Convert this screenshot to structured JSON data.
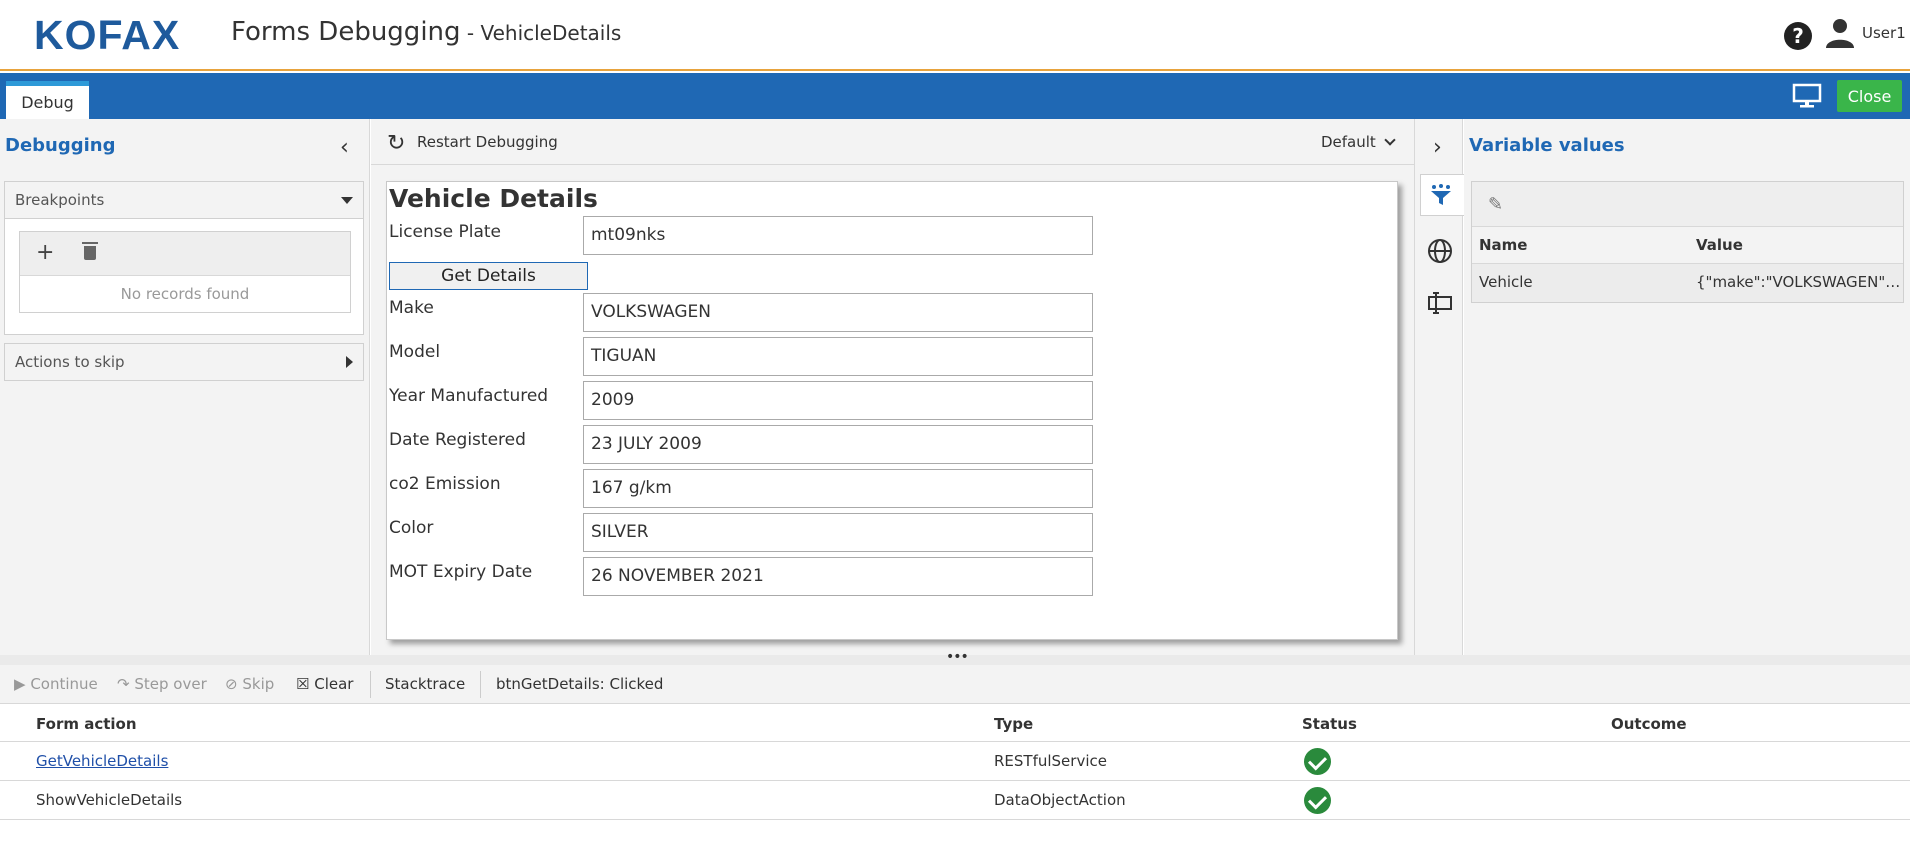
{
  "header": {
    "logo": "KOFAX",
    "title": "Forms Debugging",
    "subtitle": " - VehicleDetails",
    "help_icon": "?",
    "user": "User1"
  },
  "toolbar": {
    "tab": "Debug",
    "close_label": "Close"
  },
  "left_panel": {
    "title": "Debugging",
    "breakpoints_label": "Breakpoints",
    "add_symbol": "+",
    "empty_text": "No records found",
    "actions_to_skip_label": "Actions to skip"
  },
  "center": {
    "restart_label": "Restart Debugging",
    "profile": "Default",
    "form": {
      "title": "Vehicle Details",
      "license_plate_label": "License Plate",
      "license_plate_value": "mt09nks",
      "get_details_label": "Get Details",
      "fields": [
        {
          "label": "Make",
          "value": "VOLKSWAGEN"
        },
        {
          "label": "Model",
          "value": "TIGUAN"
        },
        {
          "label": "Year Manufactured",
          "value": "2009"
        },
        {
          "label": "Date Registered",
          "value": "23 JULY 2009"
        },
        {
          "label": "co2 Emission",
          "value": "167 g/km"
        },
        {
          "label": "Color",
          "value": "SILVER"
        },
        {
          "label": "MOT Expiry Date",
          "value": "26 NOVEMBER 2021"
        }
      ]
    }
  },
  "right_panel": {
    "title": "Variable values",
    "columns": [
      "Name",
      "Value"
    ],
    "rows": [
      {
        "name": "Vehicle",
        "value": "{\"make\":\"VOLKSWAGEN\",\"model\":\"TIGUAN\"}"
      }
    ]
  },
  "debug_bar": {
    "continue": "Continue",
    "step_over": "Step over",
    "skip": "Skip",
    "clear": "Clear",
    "stacktrace": "Stacktrace",
    "event": "btnGetDetails: Clicked"
  },
  "actions_table": {
    "columns": [
      "Form action",
      "Type",
      "Status",
      "Outcome"
    ],
    "rows": [
      {
        "action": "GetVehicleDetails",
        "type": "RESTfulService",
        "status": "success",
        "outcome": ""
      },
      {
        "action": "ShowVehicleDetails",
        "type": "DataObjectAction",
        "status": "success",
        "outcome": ""
      }
    ]
  },
  "colors": {
    "brand_blue": "#1f68b4",
    "accent_orange": "#e8a33d",
    "close_green": "#3ab54a",
    "status_green": "#2a8a3c"
  }
}
